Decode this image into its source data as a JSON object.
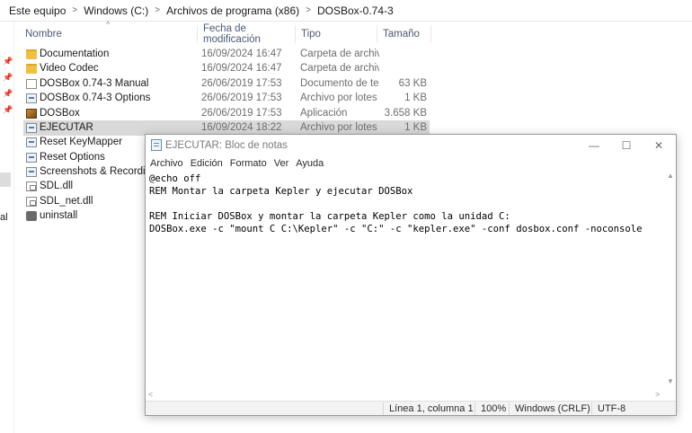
{
  "explorer": {
    "breadcrumb": [
      "Este equipo",
      "Windows (C:)",
      "Archivos de programa (x86)",
      "DOSBox-0.74-3"
    ],
    "columns": {
      "name": "Nombre",
      "date": "Fecha de modificación",
      "type": "Tipo",
      "size": "Tamaño"
    },
    "nav_fragment": "al",
    "files": [
      {
        "name": "Documentation",
        "date": "16/09/2024 16:47",
        "type": "Carpeta de archivos",
        "size": "",
        "icon": "folder-icon"
      },
      {
        "name": "Video Codec",
        "date": "16/09/2024 16:47",
        "type": "Carpeta de archivos",
        "size": "",
        "icon": "folder-icon"
      },
      {
        "name": "DOSBox 0.74-3 Manual",
        "date": "26/06/2019 17:53",
        "type": "Documento de tex...",
        "size": "63 KB",
        "icon": "text-document-icon"
      },
      {
        "name": "DOSBox 0.74-3 Options",
        "date": "26/06/2019 17:53",
        "type": "Archivo por lotes ...",
        "size": "1 KB",
        "icon": "batch-file-icon"
      },
      {
        "name": "DOSBox",
        "date": "26/06/2019 17:53",
        "type": "Aplicación",
        "size": "3.658 KB",
        "icon": "dosbox-app-icon"
      },
      {
        "name": "EJECUTAR",
        "date": "16/09/2024 18:22",
        "type": "Archivo por lotes ...",
        "size": "1 KB",
        "icon": "batch-file-icon",
        "selected": true
      },
      {
        "name": "Reset KeyMapper",
        "date": "",
        "type": "",
        "size": "",
        "icon": "batch-file-icon"
      },
      {
        "name": "Reset Options",
        "date": "",
        "type": "",
        "size": "",
        "icon": "batch-file-icon"
      },
      {
        "name": "Screenshots & Recordings",
        "date": "",
        "type": "",
        "size": "",
        "icon": "batch-file-icon"
      },
      {
        "name": "SDL.dll",
        "date": "",
        "type": "",
        "size": "",
        "icon": "dll-file-icon"
      },
      {
        "name": "SDL_net.dll",
        "date": "",
        "type": "",
        "size": "",
        "icon": "dll-file-icon"
      },
      {
        "name": "uninstall",
        "date": "",
        "type": "",
        "size": "",
        "icon": "uninstall-icon"
      }
    ]
  },
  "notepad": {
    "title": "EJECUTAR: Bloc de notas",
    "window_buttons": {
      "minimize": "—",
      "maximize": "☐",
      "close": "✕"
    },
    "menu": [
      "Archivo",
      "Edición",
      "Formato",
      "Ver",
      "Ayuda"
    ],
    "content": "@echo off\nREM Montar la carpeta Kepler y ejecutar DOSBox\n\nREM Iniciar DOSBox y montar la carpeta Kepler como la unidad C:\nDOSBox.exe -c \"mount C C:\\Kepler\" -c \"C:\" -c \"kepler.exe\" -conf dosbox.conf -noconsole",
    "status": {
      "position": "Línea 1, columna 1",
      "zoom": "100%",
      "line_ending": "Windows (CRLF)",
      "encoding": "UTF-8"
    }
  }
}
